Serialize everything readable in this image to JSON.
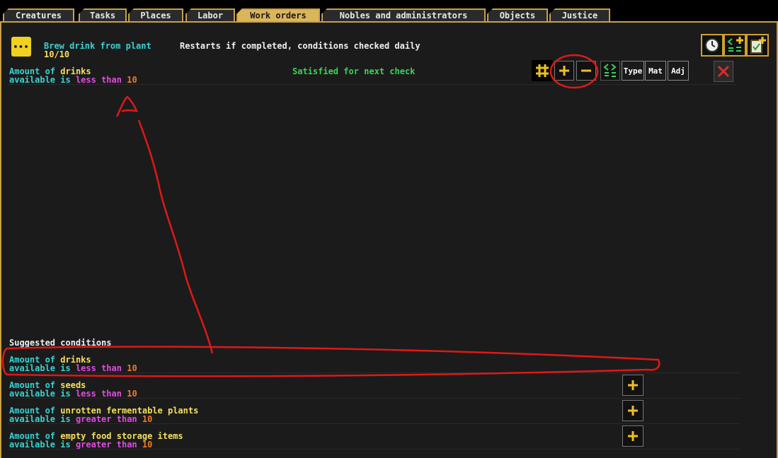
{
  "tabs": [
    {
      "label": "Creatures"
    },
    {
      "label": "Tasks"
    },
    {
      "label": "Places"
    },
    {
      "label": "Labor"
    },
    {
      "label": "Work orders"
    },
    {
      "label": "Nobles and administrators"
    },
    {
      "label": "Objects"
    },
    {
      "label": "Justice"
    }
  ],
  "order": {
    "title": "Brew drink from plant",
    "progress": "10/10",
    "repeat_text": "Restarts if completed, conditions checked daily"
  },
  "active_condition": {
    "line1_prefix": "Amount of",
    "line1_item": "drinks",
    "line2_prefix": "available is",
    "comparator": "less",
    "than": "than",
    "value": "10",
    "status": "Satisfied for next check"
  },
  "condition_buttons": {
    "type": "Type",
    "mat": "Mat",
    "adj": "Adj"
  },
  "suggested": {
    "heading": "Suggested conditions",
    "items": [
      {
        "prefix": "Amount of",
        "item": "drinks",
        "available": "available is",
        "comparator": "less",
        "than": "than",
        "value": "10"
      },
      {
        "prefix": "Amount of",
        "item": "seeds",
        "available": "available is",
        "comparator": "less",
        "than": "than",
        "value": "10"
      },
      {
        "prefix": "Amount of",
        "item": "unrotten fermentable plants",
        "available": "available is",
        "comparator": "greater",
        "than": "than",
        "value": "10"
      },
      {
        "prefix": "Amount of",
        "item": "empty food storage items",
        "available": "available is",
        "comparator": "greater",
        "than": "than",
        "value": "10"
      }
    ]
  },
  "colors": {
    "accent": "#c8a048",
    "active_tab": "#dab55a",
    "annotation": "#e01818"
  }
}
